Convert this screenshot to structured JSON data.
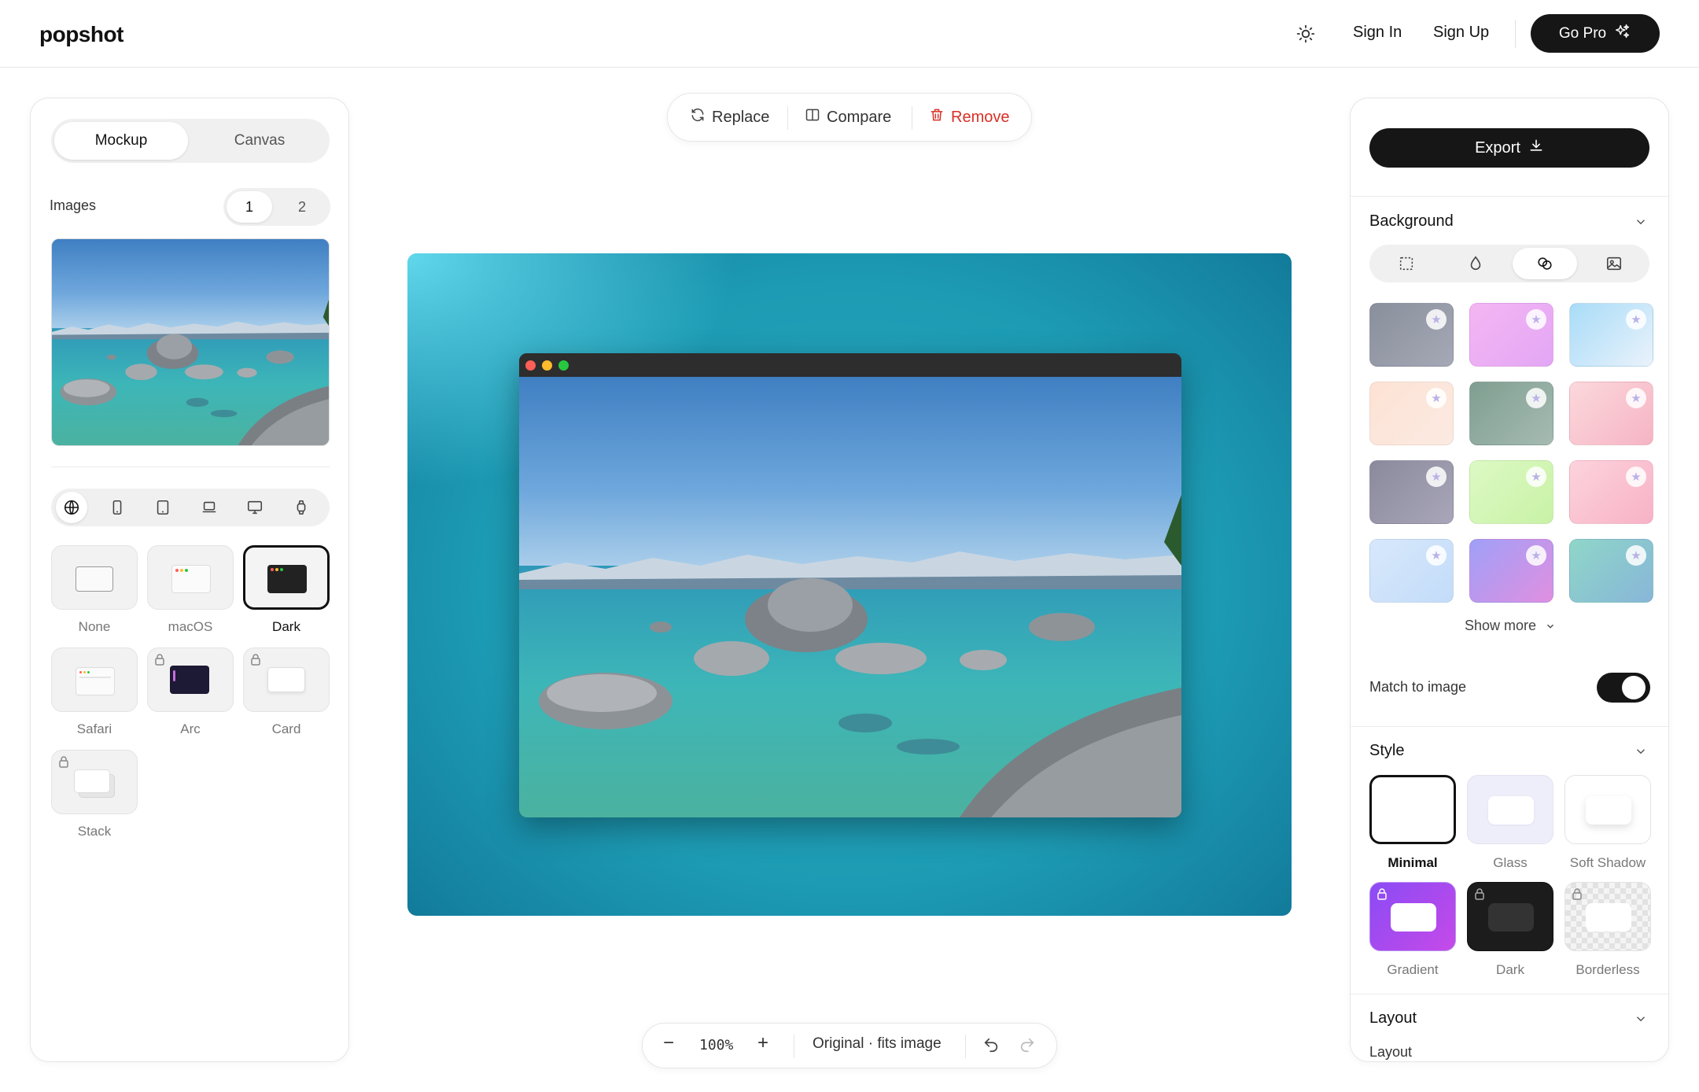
{
  "header": {
    "logo": "popshot",
    "sign_in": "Sign In",
    "sign_up": "Sign Up",
    "go_pro": "Go Pro",
    "theme_icon": "sun-icon"
  },
  "left_panel": {
    "tabs": {
      "active": "Mockup",
      "inactive": "Canvas"
    },
    "images_label": "Images",
    "image_pages": [
      "1",
      "2"
    ],
    "device_icons": [
      "globe-icon",
      "phone-icon",
      "tablet-icon",
      "laptop-icon",
      "desktop-icon",
      "watch-icon"
    ],
    "frames": [
      {
        "label": "None",
        "locked": false,
        "selected": false
      },
      {
        "label": "macOS",
        "locked": false,
        "selected": false
      },
      {
        "label": "Dark",
        "locked": false,
        "selected": true
      },
      {
        "label": "Safari",
        "locked": false,
        "selected": false
      },
      {
        "label": "Arc",
        "locked": true,
        "selected": false
      },
      {
        "label": "Card",
        "locked": true,
        "selected": false
      },
      {
        "label": "Stack",
        "locked": true,
        "selected": false
      }
    ]
  },
  "toolbar": {
    "replace": "Replace",
    "compare": "Compare",
    "remove": "Remove"
  },
  "zoombar": {
    "zoom": "100%",
    "size_mode": "Original · fits image"
  },
  "right_panel": {
    "export": "Export",
    "background": {
      "title": "Background",
      "tabs": [
        "transparent-icon",
        "droplet-icon",
        "blend-icon",
        "image-icon"
      ],
      "active_tab": 2,
      "swatches": [
        [
          "#8a8f9c",
          "#a5a9b6"
        ],
        [
          "#f4b6f2",
          "#e3a6f5"
        ],
        [
          "#a8dcf8",
          "#eaf2fb"
        ],
        [
          "#fde2d4",
          "#fbeae2"
        ],
        [
          "#7f9e90",
          "#a6bbb3"
        ],
        [
          "#fbd8dc",
          "#f6b4c4"
        ],
        [
          "#8b8a9c",
          "#a8a6b8"
        ],
        [
          "#dcf9c4",
          "#c9f2a6"
        ],
        [
          "#fcd3dc",
          "#f8b2c6"
        ],
        [
          "#d7e8fb",
          "#c3dcf9"
        ],
        [
          "#9fa0f8",
          "#e08fe0"
        ],
        [
          "#8fd6c8",
          "#88b6d8"
        ]
      ],
      "show_more": "Show more",
      "match_label": "Match to image",
      "match_on": true
    },
    "style": {
      "title": "Style",
      "options": [
        {
          "label": "Minimal",
          "selected": true,
          "locked": false
        },
        {
          "label": "Glass",
          "selected": false,
          "locked": false
        },
        {
          "label": "Soft Shadow",
          "selected": false,
          "locked": false
        },
        {
          "label": "Gradient",
          "selected": false,
          "locked": true
        },
        {
          "label": "Dark",
          "selected": false,
          "locked": true
        },
        {
          "label": "Borderless",
          "selected": false,
          "locked": true
        }
      ]
    },
    "layout": {
      "title": "Layout",
      "sub": "Layout"
    }
  },
  "colors": {
    "accent_dark": "#161616",
    "remove_red": "#d93025",
    "canvas_teal": "#1d9bb4"
  }
}
